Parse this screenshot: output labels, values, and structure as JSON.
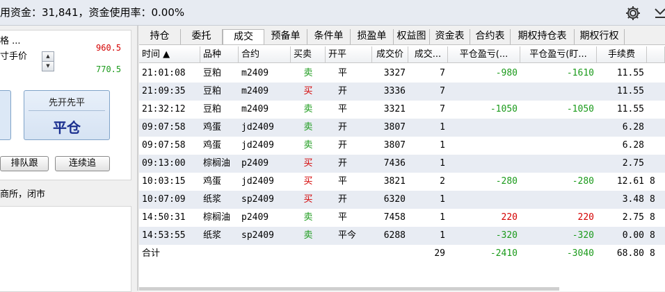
{
  "topbar": {
    "title": "用资金：31,841，资金使用率：0.00%",
    "icons": [
      "gear-icon",
      "collapse-icon"
    ]
  },
  "order_panel": {
    "price_type": "格 ...",
    "price_mode": "寸手价",
    "ask_price": "960.5",
    "bid_price": "770.5",
    "close_button": {
      "sub_label": "先开先平",
      "label": "平仓"
    },
    "queue_button": "排队跟",
    "follow_button": "连续追",
    "exchange_status": "商所，闭市"
  },
  "tabs": [
    {
      "label": "持仓",
      "active": false
    },
    {
      "label": "委托",
      "active": false
    },
    {
      "label": "成交",
      "active": true
    },
    {
      "label": "预备单",
      "active": false
    },
    {
      "label": "条件单",
      "active": false
    },
    {
      "label": "损盈单",
      "active": false
    },
    {
      "label": "权益图",
      "active": false
    },
    {
      "label": "资金表",
      "active": false
    },
    {
      "label": "合约表",
      "active": false
    },
    {
      "label": "期权持仓表",
      "active": false
    },
    {
      "label": "期权行权",
      "active": false
    }
  ],
  "table": {
    "headers": [
      "时间 ▲",
      "品种",
      "合约",
      "买卖",
      "开平",
      "成交价",
      "成交...",
      "平仓盈亏(...",
      "平仓盈亏(盯...",
      "手续费"
    ],
    "rows": [
      {
        "time": "21:01:08",
        "variety": "豆粕",
        "contract": "m2409",
        "side": "卖",
        "offset": "平",
        "price": "3327",
        "qty": "7",
        "pnl1": "-980",
        "pnl2": "-1610",
        "fee": "11.55",
        "extra": ""
      },
      {
        "time": "21:09:35",
        "variety": "豆粕",
        "contract": "m2409",
        "side": "买",
        "offset": "开",
        "price": "3336",
        "qty": "7",
        "pnl1": "",
        "pnl2": "",
        "fee": "11.55",
        "extra": ""
      },
      {
        "time": "21:32:12",
        "variety": "豆粕",
        "contract": "m2409",
        "side": "卖",
        "offset": "平",
        "price": "3321",
        "qty": "7",
        "pnl1": "-1050",
        "pnl2": "-1050",
        "fee": "11.55",
        "extra": ""
      },
      {
        "time": "09:07:58",
        "variety": "鸡蛋",
        "contract": "jd2409",
        "side": "卖",
        "offset": "开",
        "price": "3807",
        "qty": "1",
        "pnl1": "",
        "pnl2": "",
        "fee": "6.28",
        "extra": ""
      },
      {
        "time": "09:07:58",
        "variety": "鸡蛋",
        "contract": "jd2409",
        "side": "卖",
        "offset": "开",
        "price": "3807",
        "qty": "1",
        "pnl1": "",
        "pnl2": "",
        "fee": "6.28",
        "extra": ""
      },
      {
        "time": "09:13:00",
        "variety": "棕榈油",
        "contract": "p2409",
        "side": "买",
        "offset": "开",
        "price": "7436",
        "qty": "1",
        "pnl1": "",
        "pnl2": "",
        "fee": "2.75",
        "extra": ""
      },
      {
        "time": "10:03:15",
        "variety": "鸡蛋",
        "contract": "jd2409",
        "side": "买",
        "offset": "平",
        "price": "3821",
        "qty": "2",
        "pnl1": "-280",
        "pnl2": "-280",
        "fee": "12.61",
        "extra": "8"
      },
      {
        "time": "10:07:09",
        "variety": "纸浆",
        "contract": "sp2409",
        "side": "买",
        "offset": "开",
        "price": "6320",
        "qty": "1",
        "pnl1": "",
        "pnl2": "",
        "fee": "3.48",
        "extra": "8"
      },
      {
        "time": "14:50:31",
        "variety": "棕榈油",
        "contract": "p2409",
        "side": "卖",
        "offset": "平",
        "price": "7458",
        "qty": "1",
        "pnl1": "220",
        "pnl2": "220",
        "fee": "2.75",
        "extra": "8"
      },
      {
        "time": "14:53:55",
        "variety": "纸浆",
        "contract": "sp2409",
        "side": "卖",
        "offset": "平今",
        "price": "6288",
        "qty": "1",
        "pnl1": "-320",
        "pnl2": "-320",
        "fee": "0.00",
        "extra": "8"
      }
    ],
    "total": {
      "label": "合计",
      "qty": "29",
      "pnl1": "-2410",
      "pnl2": "-3040",
      "fee": "68.80",
      "extra": "8"
    }
  },
  "colors": {
    "sell": "#1a9a1a",
    "buy": "#d40000",
    "loss": "#1a9a1a",
    "profit": "#d40000",
    "accent": "#1a2f8f"
  }
}
